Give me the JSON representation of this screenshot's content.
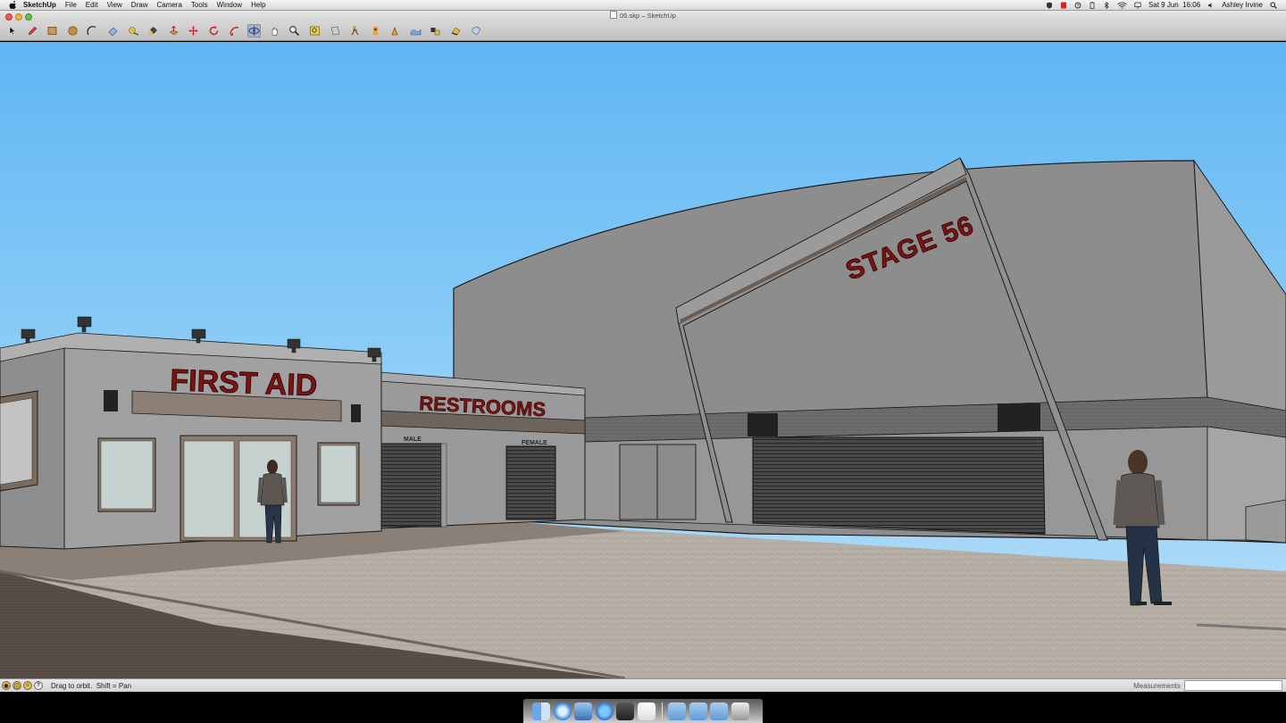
{
  "menubar": {
    "app_name": "SketchUp",
    "menus": [
      "File",
      "Edit",
      "View",
      "Draw",
      "Camera",
      "Tools",
      "Window",
      "Help"
    ],
    "datetime": "Sat 9 Jun  16:06",
    "user": "Ashley Irvine"
  },
  "window": {
    "title": "05.skp – SketchUp"
  },
  "toolbar": {
    "tools": [
      "select-icon",
      "pencil-icon",
      "rectangle-icon",
      "circle-icon",
      "arc-icon",
      "eraser-icon",
      "tape-measure-icon",
      "paint-bucket-icon",
      "push-pull-icon",
      "move-icon",
      "rotate-icon",
      "follow-me-icon",
      "orbit-icon",
      "pan-icon",
      "zoom-icon",
      "zoom-extents-icon",
      "section-plane-icon",
      "walk-icon",
      "look-around-icon",
      "position-camera-icon",
      "sandbox-icon",
      "components-icon",
      "shadows-icon",
      "styles-icon"
    ],
    "active_tool": "orbit-icon"
  },
  "scene": {
    "sign_first_aid": "FIRST AID",
    "sign_restrooms": "RESTROOMS",
    "sign_male": "MALE",
    "sign_female": "FEMALE",
    "sign_stage": "STAGE 56",
    "sign_color": "#7a1414"
  },
  "statusbar": {
    "hint": "Drag to orbit.  Shift = Pan",
    "measurements_label": "Measurements",
    "measurements_value": ""
  },
  "dock": {
    "items": [
      "finder-icon",
      "safari-icon",
      "preview-icon",
      "itunes-icon",
      "photo-booth-icon",
      "textedit-icon",
      "applications-folder-icon",
      "documents-folder-icon",
      "downloads-folder-icon",
      "trash-icon"
    ]
  }
}
